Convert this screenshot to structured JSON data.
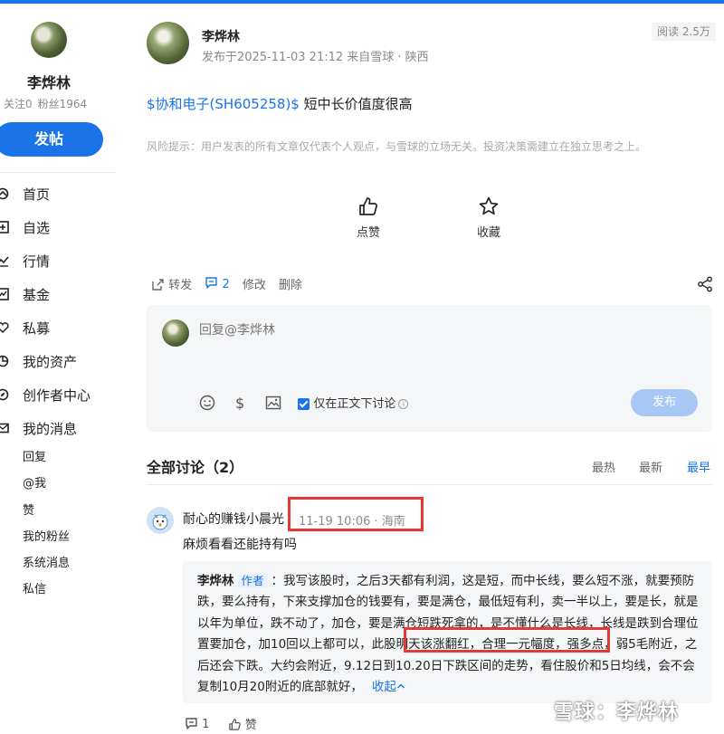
{
  "colors": {
    "accent": "#1a73e8",
    "highlight_box": "#e53935",
    "muted": "#8a8a8a"
  },
  "sidebar": {
    "user_name": "李烨林",
    "following": "关注0",
    "followers": "粉丝1964",
    "post_button": "发帖",
    "nav": [
      {
        "label": "首页",
        "icon": "home-icon"
      },
      {
        "label": "自选",
        "icon": "plus-box-icon"
      },
      {
        "label": "行情",
        "icon": "trend-icon"
      },
      {
        "label": "基金",
        "icon": "fund-chart-icon"
      },
      {
        "label": "私募",
        "icon": "heart-chart-icon"
      },
      {
        "label": "我的资产",
        "icon": "pie-icon"
      },
      {
        "label": "创作者中心",
        "icon": "compass-icon"
      },
      {
        "label": "我的消息",
        "icon": "mail-icon"
      }
    ],
    "messages": [
      "回复",
      "@我",
      "赞",
      "我的粉丝",
      "系统消息",
      "私信"
    ]
  },
  "post": {
    "author": "李烨林",
    "meta": "发布于2025-11-03 21:12  来自雪球 · 陕西",
    "read_count": "阅读 2.5万",
    "stock_link": "$协和电子(SH605258)$",
    "content": " 短中长价值度很高",
    "risk_notice": "风险提示：用户发表的所有文章仅代表个人观点，与雪球的立场无关。投资决策需建立在独立思考之上。",
    "like_label": "点赞",
    "collect_label": "收藏"
  },
  "toolbar": {
    "repost": "转发",
    "comment_count": "2",
    "edit": "修改",
    "delete": "删除"
  },
  "reply": {
    "placeholder": "回复@李烨林",
    "checkbox_label": "仅在正文下讨论",
    "publish": "发布"
  },
  "discussion": {
    "title": "全部讨论（2）",
    "sort": [
      "最热",
      "最新",
      "最早"
    ],
    "comment": {
      "author": "耐心的赚钱小晨光",
      "meta": "11-19 10:06 · 海南",
      "text": "麻烦看看还能持有吗",
      "reply_author": "李烨林",
      "reply_tag": "作者",
      "reply_text": "：我写该股时，之后3天都有利润，这是短，而中长线，要么短不涨，就要预防跌，要么持有，下来支撑加仓的钱要有，要是满仓，最低短有利，卖一半以上，要是长，就是以年为单位，跌不动了，加仓，要是满仓短跌死拿的，是不懂什么是长线，长线是跌到合理位置要加仓，加10回以上都可以，此股明天该涨翻红，合理一元幅度，强多点，弱5毛附近，之后还会下跌。大约会附近，9.12日到10.20日下跌区间的走势，看住股价和5日均线，会不会复制10月20附近的底部就好，",
      "collapse": "收起",
      "reply_count": "1",
      "like": "赞"
    }
  },
  "watermark": "雪球：李烨林"
}
